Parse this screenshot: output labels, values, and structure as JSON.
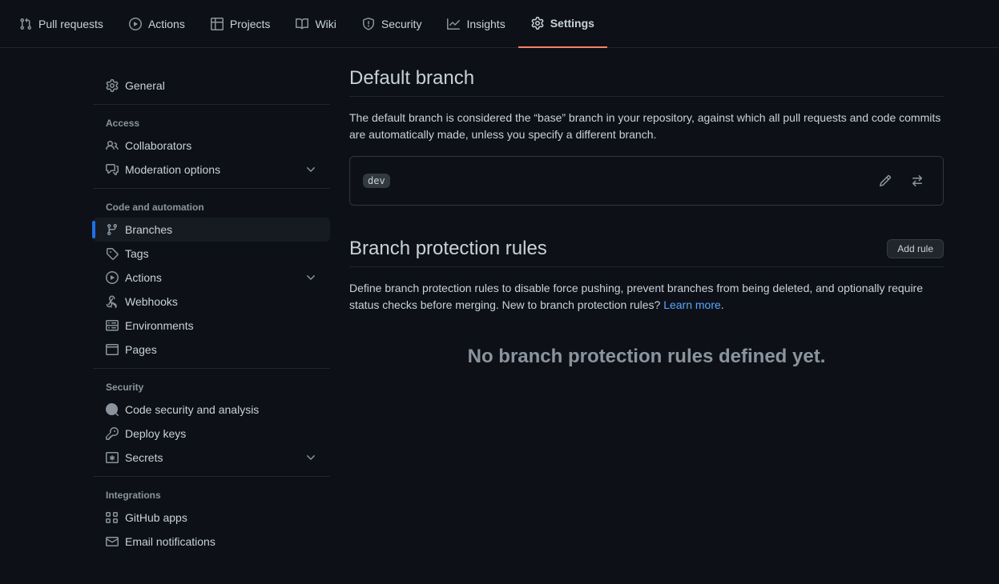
{
  "topnav": {
    "pull_requests": "Pull requests",
    "actions": "Actions",
    "projects": "Projects",
    "wiki": "Wiki",
    "security": "Security",
    "insights": "Insights",
    "settings": "Settings"
  },
  "sidebar": {
    "general": "General",
    "groups": {
      "access": {
        "title": "Access",
        "collaborators": "Collaborators",
        "moderation": "Moderation options"
      },
      "code": {
        "title": "Code and automation",
        "branches": "Branches",
        "tags": "Tags",
        "actions": "Actions",
        "webhooks": "Webhooks",
        "environments": "Environments",
        "pages": "Pages"
      },
      "security": {
        "title": "Security",
        "code_security": "Code security and analysis",
        "deploy_keys": "Deploy keys",
        "secrets": "Secrets"
      },
      "integrations": {
        "title": "Integrations",
        "github_apps": "GitHub apps",
        "email_notifications": "Email notifications"
      }
    }
  },
  "main": {
    "default_branch": {
      "title": "Default branch",
      "desc": "The default branch is considered the “base” branch in your repository, against which all pull requests and code commits are automatically made, unless you specify a different branch.",
      "branch": "dev"
    },
    "protection": {
      "title": "Branch protection rules",
      "add_rule": "Add rule",
      "desc_prefix": "Define branch protection rules to disable force pushing, prevent branches from being deleted, and optionally require status checks before merging. New to branch protection rules? ",
      "learn_more": "Learn more",
      "desc_suffix": ".",
      "empty": "No branch protection rules defined yet."
    }
  }
}
